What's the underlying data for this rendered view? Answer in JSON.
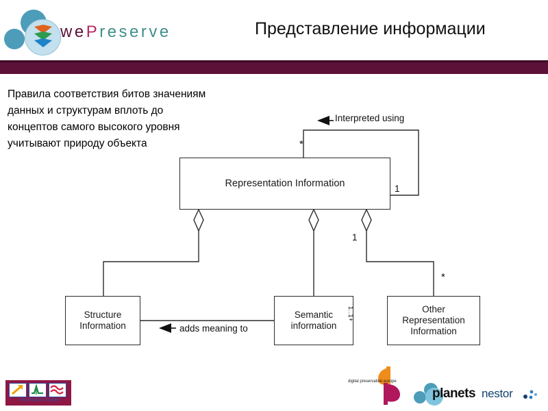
{
  "header": {
    "brand_we": "we",
    "brand_p": "P",
    "brand_reserve": "reserve",
    "title": "Представление информации",
    "band_color": "#5b1138",
    "brand_we_color": "#5b1138",
    "brand_p_color": "#b4295c",
    "brand_reserve_color": "#3f8f8c"
  },
  "body": {
    "paragraph_lines": [
      "Правила  соответствия битов значениям",
      "данных     и  структурам  вплоть  до",
      "концептов   самого   высокого   уровня",
      "учитывают природу объекта"
    ],
    "paragraph_full": "Правила соответствия битов значениям данных и структурам вплоть до концептов самого высокого уровня учитывают природу объекта"
  },
  "diagram": {
    "type": "uml-class-diagram",
    "boxes": {
      "representation_information": "Representation Information",
      "structure_information": "Structure\nInformation",
      "structure_information_line1": "Structure",
      "structure_information_line2": "Information",
      "semantic_information_line1": "Semantic",
      "semantic_information_line2": "information",
      "other_representation_line1": "Other",
      "other_representation_line2": "Representation",
      "other_representation_line3": "Information"
    },
    "edge_labels": {
      "interpreted_using": "Interpreted using",
      "adds_meaning_to": "adds meaning to"
    },
    "multiplicities": {
      "self_loop_source": "*",
      "self_loop_target": "1",
      "third_aggregation": "1",
      "other_representation": "*",
      "semantic_rotated": "1..1+"
    },
    "line_color": "#2b2b2b"
  },
  "footer": {
    "eu_caption": "Information Society",
    "dpe_caption": "digital preservation europe",
    "dpe_letters": "dp",
    "planets_word": "planets",
    "nestor_word": "nestor"
  }
}
